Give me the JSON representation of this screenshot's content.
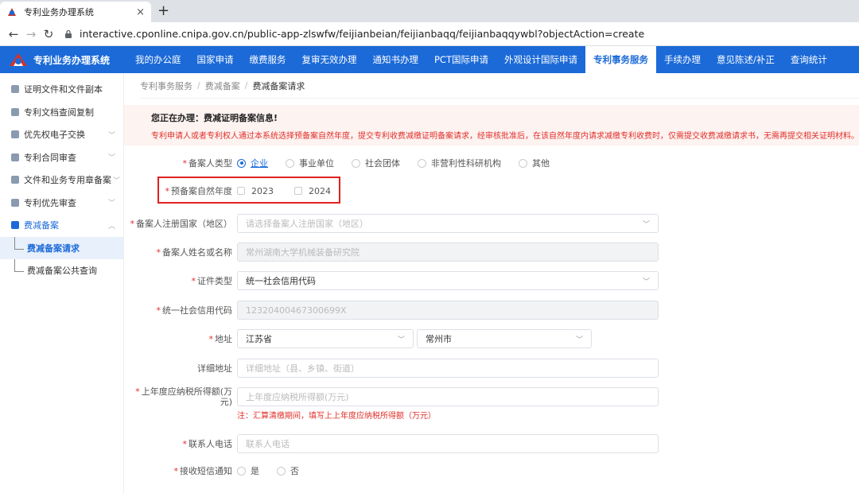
{
  "browser": {
    "tab_title": "专利业务办理系统",
    "tab_close": "×",
    "new_tab": "+",
    "url": "interactive.cponline.cnipa.gov.cn/public-app-zlswfw/feijianbeian/feijianbaqq/feijianbaqqywbl?objectAction=create"
  },
  "header": {
    "brand": "专利业务办理系统",
    "nav": [
      "我的办公庭",
      "国家申请",
      "缴费服务",
      "复审无效办理",
      "通知书办理",
      "PCT国际申请",
      "外观设计国际申请",
      "专利事务服务",
      "手续办理",
      "意见陈述/补正",
      "查询统计"
    ],
    "active_index": 7
  },
  "sidebar": {
    "items": [
      {
        "label": "证明文件和文件副本"
      },
      {
        "label": "专利文档查阅复制"
      },
      {
        "label": "优先权电子交换"
      },
      {
        "label": "专利合同审查"
      },
      {
        "label": "文件和业务专用章备案"
      },
      {
        "label": "专利优先审查"
      },
      {
        "label": "费减备案"
      }
    ],
    "sub_items": [
      {
        "label": "费减备案请求"
      },
      {
        "label": "费减备案公共查询"
      }
    ]
  },
  "breadcrumb": [
    "专利事务服务",
    "费减备案",
    "费减备案请求"
  ],
  "notice": {
    "title": "您正在办理：费减证明备案信息!",
    "text": "专利申请人或者专利权人通过本系统选择预备案自然年度，提交专利收费减缴证明备案请求，经审核批准后，在该自然年度内请求减缴专利收费时，仅需提交收费减缴请求书，无需再提交相关证明材料。"
  },
  "form": {
    "applicant_type": {
      "label": "备案人类型",
      "options": [
        "企业",
        "事业单位",
        "社会团体",
        "非营利性科研机构",
        "其他"
      ],
      "selected": 0
    },
    "year": {
      "label": "预备案自然年度",
      "options": [
        "2023",
        "2024"
      ]
    },
    "country": {
      "label": "备案人注册国家（地区）",
      "placeholder": "请选择备案人注册国家（地区）"
    },
    "name": {
      "label": "备案人姓名或名称",
      "value": "常州湖南大学机械装备研究院"
    },
    "id_type": {
      "label": "证件类型",
      "value": "统一社会信用代码"
    },
    "credit_code": {
      "label": "统一社会信用代码",
      "value": "12320400467300699X"
    },
    "address": {
      "label": "地址",
      "province": "江苏省",
      "city": "常州市"
    },
    "detail_address": {
      "label": "详细地址",
      "placeholder": "详细地址（县、乡镇、街道）"
    },
    "income": {
      "label": "上年度应纳税所得额(万元)",
      "placeholder": "上年度应纳税所得额(万元)",
      "note": "注：汇算清缴期间，填写上上年度应纳税所得额（万元）"
    },
    "phone": {
      "label": "联系人电话",
      "placeholder": "联系人电话"
    },
    "sms": {
      "label": "接收短信通知",
      "options": [
        "是",
        "否"
      ]
    }
  }
}
